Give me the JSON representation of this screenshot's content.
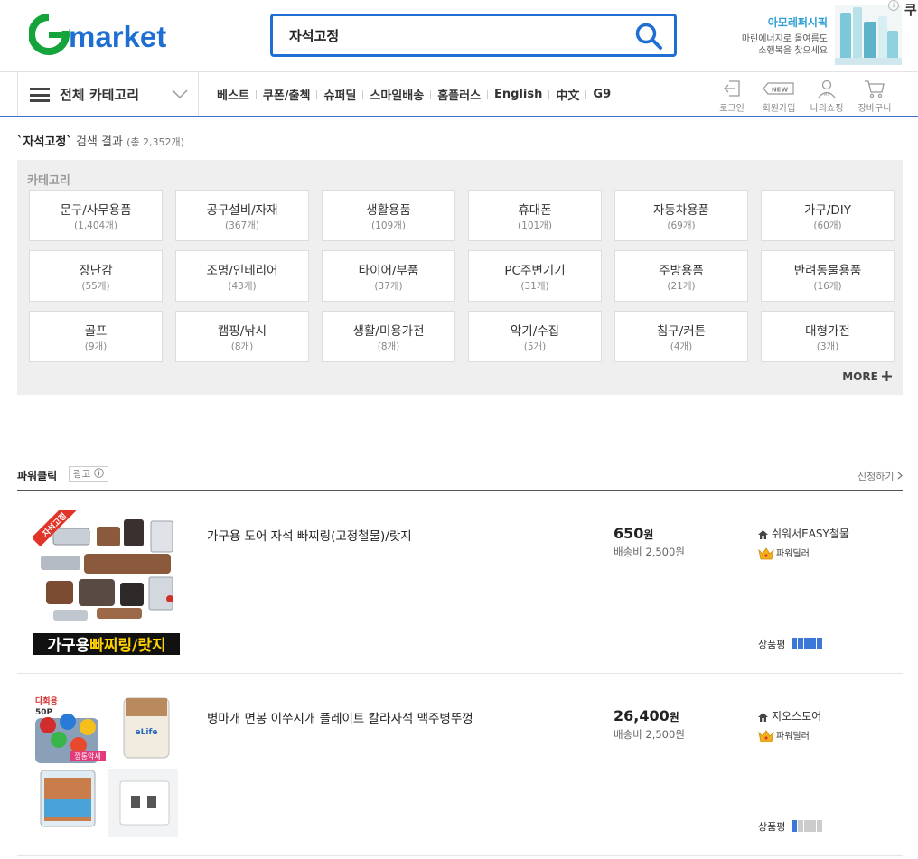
{
  "header": {
    "logo": "Gmarket",
    "search": {
      "value": "자석고정"
    },
    "promo": {
      "title": "아모레퍼시픽",
      "line1": "마린에너지로 올여름도",
      "line2": "소행복을 찾으세요"
    },
    "ad_info": "i",
    "corner_text": "쿠"
  },
  "nav": {
    "category_label": "전체 카테고리",
    "menu": [
      "베스트",
      "쿠폰/출첵",
      "슈퍼딜",
      "스마일배송",
      "홈플러스",
      "English",
      "中文",
      "G9"
    ],
    "utils": [
      {
        "label": "로그인",
        "icon": "login-icon"
      },
      {
        "label": "회원가입",
        "icon": "new-icon",
        "badge": "NEW"
      },
      {
        "label": "나의쇼핑",
        "icon": "my-icon",
        "badge": "MY"
      },
      {
        "label": "장바구니",
        "icon": "cart-icon"
      }
    ]
  },
  "result": {
    "keyword": "`자석고정`",
    "text": " 검색 결과 ",
    "count": "(총 2,352개)"
  },
  "categories": {
    "title": "카테고리",
    "more": "MORE",
    "items": [
      {
        "name": "문구/사무용품",
        "count": "(1,404개)"
      },
      {
        "name": "공구설비/자재",
        "count": "(367개)"
      },
      {
        "name": "생활용품",
        "count": "(109개)"
      },
      {
        "name": "휴대폰",
        "count": "(101개)"
      },
      {
        "name": "자동차용품",
        "count": "(69개)"
      },
      {
        "name": "가구/DIY",
        "count": "(60개)"
      },
      {
        "name": "장난감",
        "count": "(55개)"
      },
      {
        "name": "조명/인테리어",
        "count": "(43개)"
      },
      {
        "name": "타이어/부품",
        "count": "(37개)"
      },
      {
        "name": "PC주변기기",
        "count": "(31개)"
      },
      {
        "name": "주방용품",
        "count": "(21개)"
      },
      {
        "name": "반려동물용품",
        "count": "(16개)"
      },
      {
        "name": "골프",
        "count": "(9개)"
      },
      {
        "name": "캠핑/낚시",
        "count": "(8개)"
      },
      {
        "name": "생활/미용가전",
        "count": "(8개)"
      },
      {
        "name": "악기/수집",
        "count": "(5개)"
      },
      {
        "name": "침구/커튼",
        "count": "(4개)"
      },
      {
        "name": "대형가전",
        "count": "(3개)"
      }
    ]
  },
  "power_click": {
    "title": "파워클릭",
    "ad_label": "광고",
    "apply": "신청하기",
    "items": [
      {
        "title": "가구용 도어 자석 빠찌링(고정철물)/랏지",
        "price": "650",
        "won": "원",
        "shipping": "배송비 2,500원",
        "seller": "쉬워서EASY철물",
        "badge": "파워딜러",
        "rating_label": "상품평",
        "rating": 5,
        "thumb_caption1": "가구용",
        "thumb_caption2": "빠찌링/랏지",
        "thumb_sticker": "자석고정"
      },
      {
        "title": "병마개 면봉 이쑤시개 플레이트 칼라자석 맥주병뚜껑",
        "price": "26,400",
        "won": "원",
        "shipping": "배송비 2,500원",
        "seller": "지오스토어",
        "badge": "파워딜러",
        "rating_label": "상품평",
        "rating": 1,
        "thumb_label1": "다회용",
        "thumb_label2": "50P",
        "thumb_label3": "eLife",
        "thumb_label4": "깡통악세"
      }
    ]
  },
  "colors": {
    "accent": "#1f6fd2",
    "logo_green": "#15a43c",
    "rating_on": "#3b78d8"
  }
}
